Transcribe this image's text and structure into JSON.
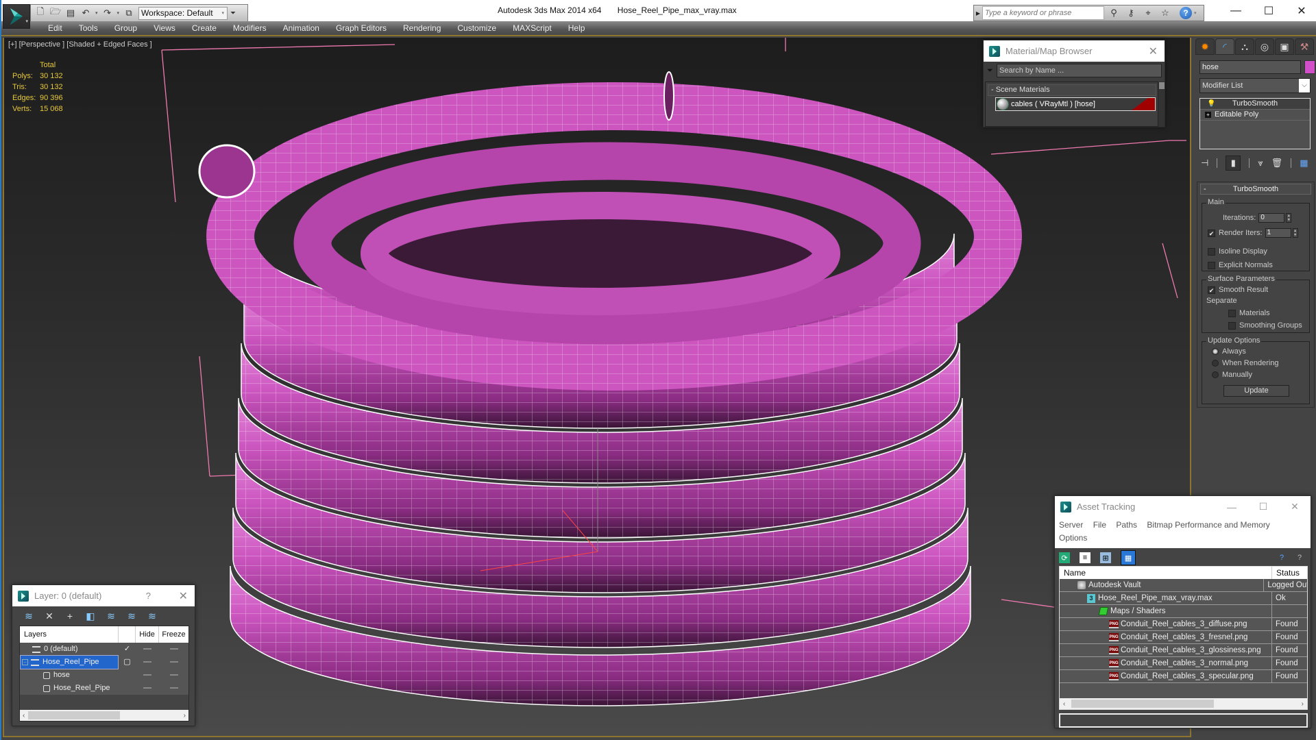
{
  "window": {
    "app_title": "Autodesk 3ds Max  2014 x64",
    "file_name": "Hose_Reel_Pipe_max_vray.max",
    "workspace": "Workspace: Default",
    "search_placeholder": "Type a keyword or phrase",
    "controls": [
      "minimize",
      "maximize",
      "close"
    ]
  },
  "quick_access": {
    "icons": [
      "new-file-icon",
      "open-file-icon",
      "save-icon",
      "undo-icon",
      "redo-icon",
      "project-folder-icon"
    ]
  },
  "menu": {
    "items": [
      "Edit",
      "Tools",
      "Group",
      "Views",
      "Create",
      "Modifiers",
      "Animation",
      "Graph Editors",
      "Rendering",
      "Customize",
      "MAXScript",
      "Help"
    ]
  },
  "viewport": {
    "label": "[+] [Perspective ] [Shaded + Edged Faces ]",
    "stats": {
      "header": "Total",
      "rows": [
        {
          "key": "Polys:",
          "value": "30 132"
        },
        {
          "key": "Tris:",
          "value": "30 132"
        },
        {
          "key": "Edges:",
          "value": "90 396"
        },
        {
          "key": "Verts:",
          "value": "15 068"
        }
      ]
    },
    "object_color": "#cc55c0"
  },
  "material_browser": {
    "title": "Material/Map Browser",
    "search_placeholder": "Search by Name ...",
    "group": "- Scene Materials",
    "item": "cables  ( VRayMtl ) [hose]",
    "swatch_color": "#a00000"
  },
  "command_panel": {
    "object_name": "hose",
    "object_color": "#d14fc8",
    "modifier_list": "Modifier List",
    "stack": [
      "TurboSmooth",
      "Editable Poly"
    ],
    "rollout": {
      "title": "TurboSmooth",
      "main_label": "Main",
      "iterations_label": "Iterations:",
      "iterations_value": "0",
      "render_iters_label": "Render Iters:",
      "render_iters_value": "1",
      "render_iters_checked": true,
      "isoline_label": "Isoline Display",
      "isoline_checked": false,
      "explicit_normals_label": "Explicit Normals",
      "explicit_normals_checked": false,
      "surface_label": "Surface Parameters",
      "smooth_result_label": "Smooth Result",
      "smooth_result_checked": true,
      "separate_label": "Separate",
      "materials_label": "Materials",
      "smoothing_groups_label": "Smoothing Groups",
      "update_options_label": "Update Options",
      "radio_options": [
        "Always",
        "When Rendering",
        "Manually"
      ],
      "radio_selected": "Always",
      "update_button": "Update"
    }
  },
  "asset_tracking": {
    "title": "Asset Tracking",
    "menu": [
      "Server",
      "File",
      "Paths",
      "Bitmap Performance and Memory",
      "Options"
    ],
    "columns": [
      "Name",
      "Status"
    ],
    "rows": [
      {
        "name": "Autodesk Vault",
        "status": "Logged Out",
        "icon": "vault-icon",
        "indent": 1
      },
      {
        "name": "Hose_Reel_Pipe_max_vray.max",
        "status": "Ok",
        "icon": "max-file-icon",
        "indent": 2
      },
      {
        "name": "Maps / Shaders",
        "status": "",
        "icon": "maps-icon",
        "indent": 3
      },
      {
        "name": "Conduit_Reel_cables_3_diffuse.png",
        "status": "Found",
        "icon": "png-icon",
        "indent": 4
      },
      {
        "name": "Conduit_Reel_cables_3_fresnel.png",
        "status": "Found",
        "icon": "png-icon",
        "indent": 4
      },
      {
        "name": "Conduit_Reel_cables_3_glossiness.png",
        "status": "Found",
        "icon": "png-icon",
        "indent": 4
      },
      {
        "name": "Conduit_Reel_cables_3_normal.png",
        "status": "Found",
        "icon": "png-icon",
        "indent": 4
      },
      {
        "name": "Conduit_Reel_cables_3_specular.png",
        "status": "Found",
        "icon": "png-icon",
        "indent": 4
      }
    ]
  },
  "layer_dialog": {
    "title": "Layer: 0 (default)",
    "help": "?",
    "columns": [
      "Layers",
      "",
      "Hide",
      "Freeze"
    ],
    "rows": [
      {
        "name": "0 (default)",
        "type": "layer",
        "current": true,
        "selected": false,
        "indent": 1
      },
      {
        "name": "Hose_Reel_Pipe",
        "type": "layer",
        "current": false,
        "selected": true,
        "indent": 0
      },
      {
        "name": "hose",
        "type": "object",
        "indent": 2
      },
      {
        "name": "Hose_Reel_Pipe",
        "type": "object",
        "indent": 2
      }
    ]
  }
}
